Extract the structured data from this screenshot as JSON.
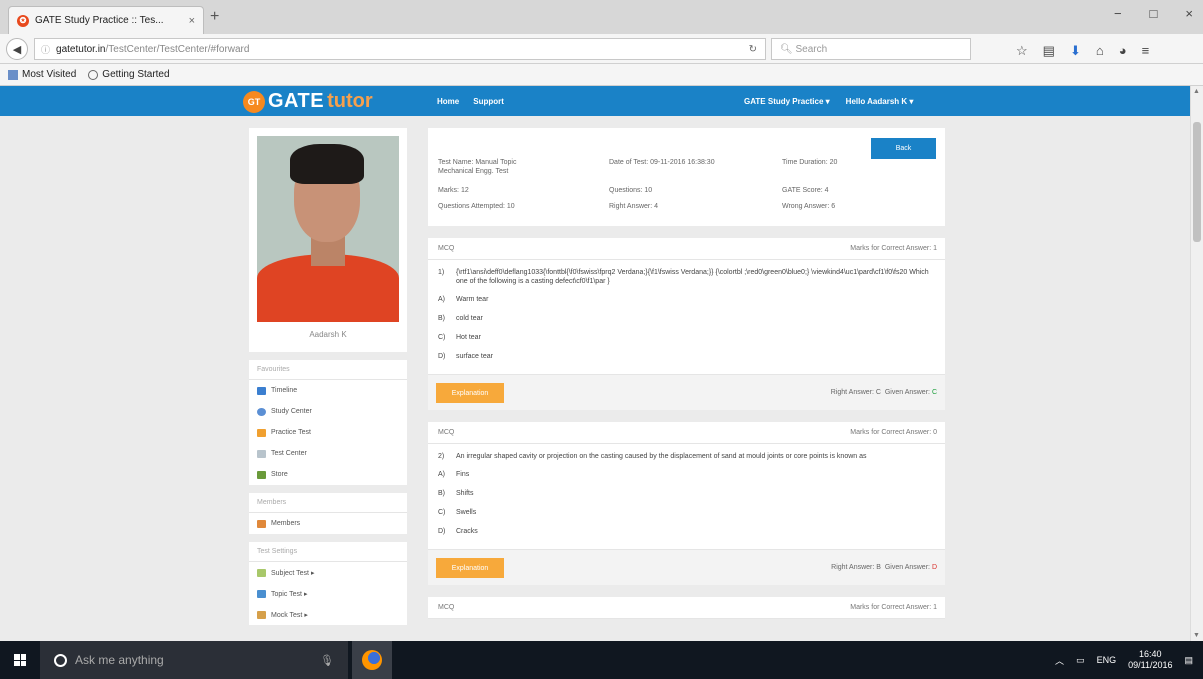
{
  "browser": {
    "tab_title": "GATE Study Practice :: Tes...",
    "tab_close": "×",
    "new_tab": "+",
    "url_domain": "gatetutor.in",
    "url_path": "/TestCenter/TestCenter/#forward",
    "search_placeholder": "Search",
    "win_min": "−",
    "win_max": "□",
    "win_close": "×",
    "bookmarks": [
      {
        "label": "Most Visited"
      },
      {
        "label": "Getting Started"
      }
    ]
  },
  "site": {
    "logo_part1": "GATE",
    "logo_part2": "tutor",
    "logo_badge": "GT",
    "nav": [
      "Home",
      "Support"
    ],
    "right_nav": [
      "GATE Study Practice ▾",
      "Hello Aadarsh K ▾"
    ]
  },
  "profile": {
    "name": "Aadarsh K"
  },
  "sidebar": {
    "favourites_title": "Favourites",
    "favourites": [
      {
        "label": "Timeline",
        "color": "#3b7fd0"
      },
      {
        "label": "Study Center",
        "color": "#5b8fd4"
      },
      {
        "label": "Practice Test",
        "color": "#f0a030"
      },
      {
        "label": "Test Center",
        "color": "#b8c4cc"
      },
      {
        "label": "Store",
        "color": "#6a9a3a"
      }
    ],
    "members_title": "Members",
    "members": [
      {
        "label": "Members",
        "color": "#e0883a"
      }
    ],
    "settings_title": "Test Settings",
    "settings": [
      {
        "label": "Subject Test ▸",
        "color": "#a8c86a"
      },
      {
        "label": "Topic Test ▸",
        "color": "#4a8fd0"
      },
      {
        "label": "Mock Test ▸",
        "color": "#d6a04a"
      }
    ]
  },
  "summary": {
    "back_label": "Back",
    "test_name": "Test Name: Manual Topic\nMechanical Engg. Test",
    "date": "Date of Test: 09-11-2016 16:38:30",
    "duration": "Time Duration: 20",
    "marks": "Marks: 12",
    "questions": "Questions: 10",
    "gate_score": "GATE Score: 4",
    "attempted": "Questions Attempted: 10",
    "right": "Right Answer: 4",
    "wrong": "Wrong Answer: 6"
  },
  "questions": [
    {
      "type": "MCQ",
      "marks": "Marks for Correct Answer: 1",
      "number": "1)",
      "text": "{\\rtf1\\ansi\\deff0\\deflang1033{\\fonttbl{\\f0\\fswiss\\fprq2 Verdana;}{\\f1\\fswiss Verdana;}} {\\colortbl ;\\red0\\green0\\blue0;} \\viewkind4\\uc1\\pard\\cf1\\f0\\fs20 Which one of the following is a casting defect\\cf0\\f1\\par }",
      "options": [
        {
          "letter": "A)",
          "text": "Warm tear"
        },
        {
          "letter": "B)",
          "text": "cold tear"
        },
        {
          "letter": "C)",
          "text": "Hot tear"
        },
        {
          "letter": "D)",
          "text": "surface tear"
        }
      ],
      "explanation": "Explanation",
      "right_answer_label": "Right Answer:",
      "right_answer": "C",
      "given_answer_label": "Given Answer:",
      "given_answer": "C",
      "correct": true
    },
    {
      "type": "MCQ",
      "marks": "Marks for Correct Answer: 0",
      "number": "2)",
      "text": "An irregular shaped cavity or projection on the casting caused by the displacement of sand at mould joints or core points is known as",
      "options": [
        {
          "letter": "A)",
          "text": "Fins"
        },
        {
          "letter": "B)",
          "text": "Shifts"
        },
        {
          "letter": "C)",
          "text": "Swells"
        },
        {
          "letter": "D)",
          "text": "Cracks"
        }
      ],
      "explanation": "Explanation",
      "right_answer_label": "Right Answer:",
      "right_answer": "B",
      "given_answer_label": "Given Answer:",
      "given_answer": "D",
      "correct": false
    },
    {
      "type": "MCQ",
      "marks": "Marks for Correct Answer: 1"
    }
  ],
  "taskbar": {
    "search_placeholder": "Ask me anything",
    "lang": "ENG",
    "time": "16:40",
    "date": "09/11/2016"
  }
}
